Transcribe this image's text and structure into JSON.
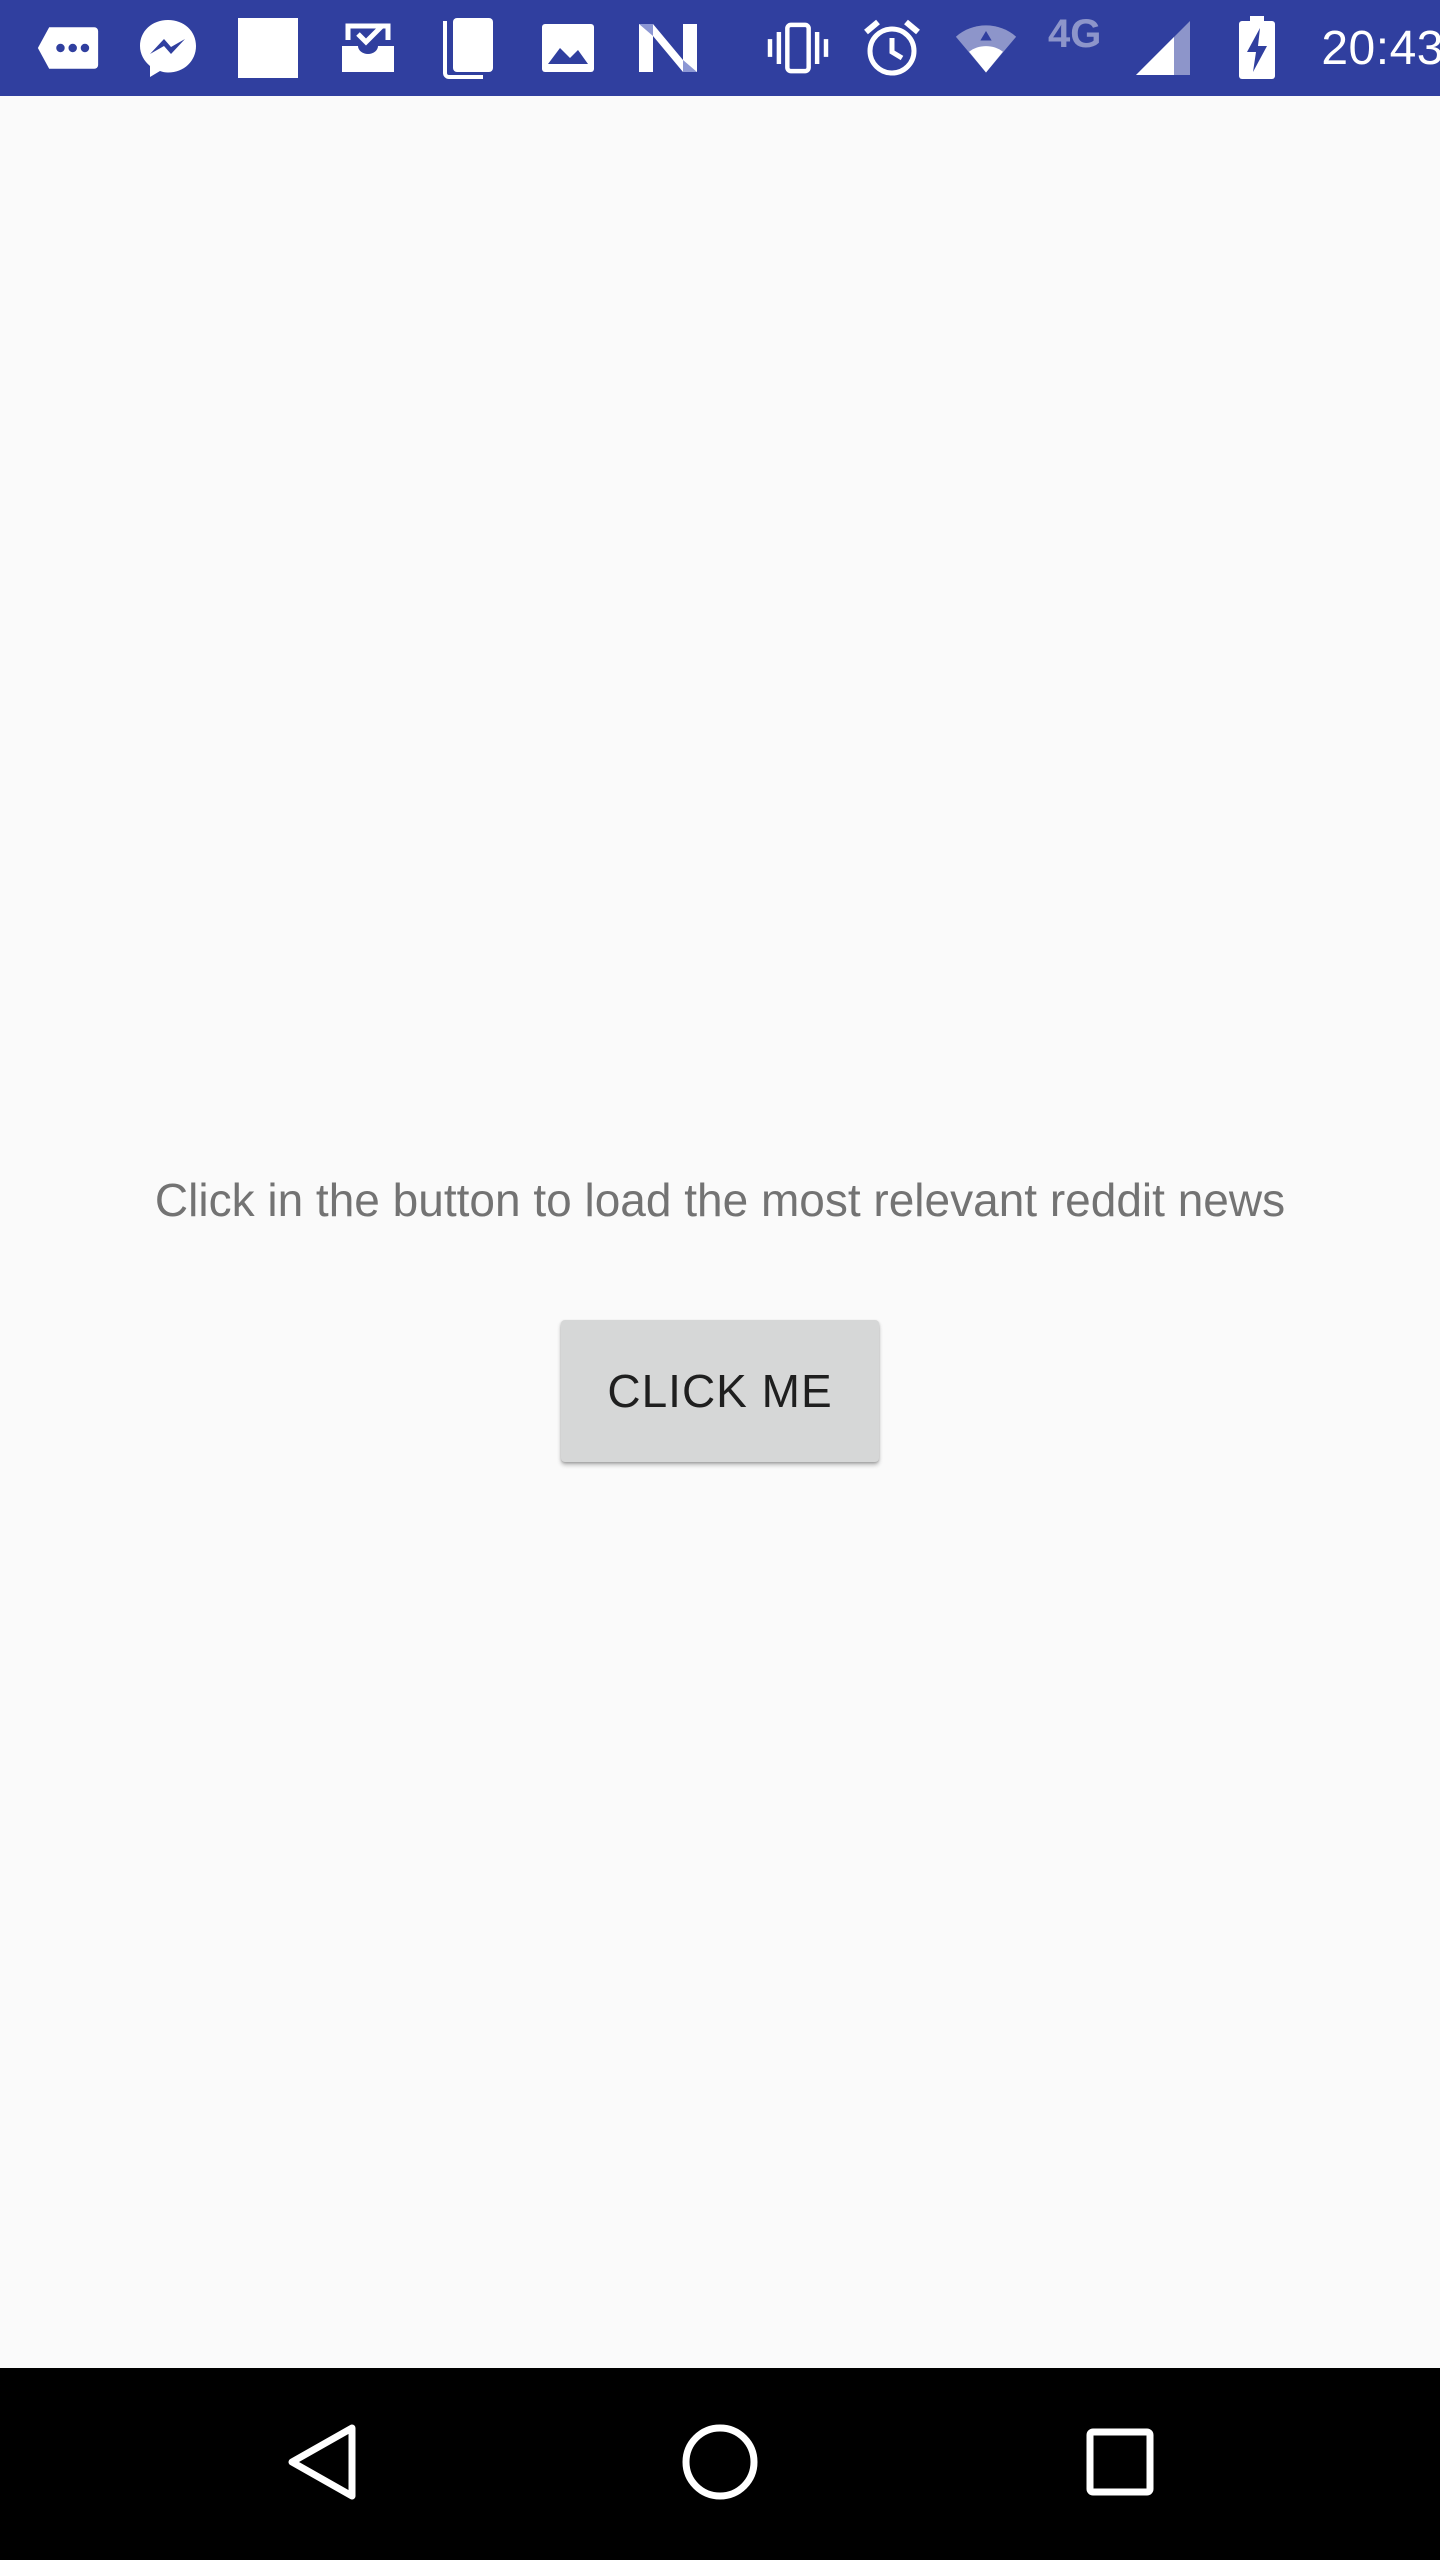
{
  "status_bar": {
    "time": "20:43",
    "network_type": "4G",
    "background_color": "#303f9f",
    "notification_icons": [
      "chat-bubble-more-icon",
      "messenger-icon",
      "white-square-icon",
      "inbox-done-icon",
      "document-icon",
      "image-icon",
      "n-logo-icon"
    ],
    "system_icons": [
      "vibrate-icon",
      "alarm-icon",
      "wifi-icon",
      "cell-signal-icon",
      "battery-charging-icon"
    ]
  },
  "main": {
    "message": "Click in the button to load the most relevant reddit news",
    "button_label": "CLICK ME",
    "message_color": "#737373",
    "button_color": "#d6d7d7"
  },
  "nav_bar": {
    "icons": [
      "back-icon",
      "home-icon",
      "recents-icon"
    ],
    "background_color": "#000000"
  }
}
